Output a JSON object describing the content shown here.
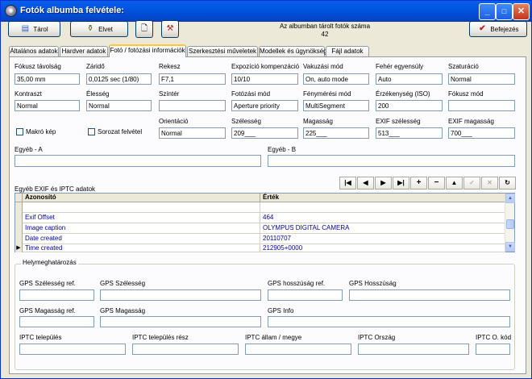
{
  "window": {
    "title": "Fotók albumba felvétele:",
    "min": "_",
    "max": "□",
    "close": "✕"
  },
  "toolbar": {
    "save_label": "Tárol",
    "discard_label": "Elvet",
    "album_count_label": "Az albumban tárolt fotók száma",
    "album_count": "42",
    "finish_label": "Befejezés"
  },
  "tabs": [
    "Általános adatok",
    "Hardver adatok",
    "Fotó / fotózási információk",
    "Szerkesztési műveletek",
    "Modellek és ügynökség",
    "Fájl adatok"
  ],
  "fields": {
    "focal_length": {
      "label": "Fókusz távolság",
      "value": "35,00 mm"
    },
    "shutter": {
      "label": "Záridő",
      "value": "0,0125 sec (1/80)"
    },
    "aperture": {
      "label": "Rekesz",
      "value": "F7,1"
    },
    "exposure_comp": {
      "label": "Expozíció kompenzáció",
      "value": "10/10"
    },
    "flash_mode": {
      "label": "Vakuzási mód",
      "value": "On, auto mode"
    },
    "white_balance": {
      "label": "Fehér egyensúly",
      "value": "Auto"
    },
    "saturation": {
      "label": "Szaturáció",
      "value": "Normal"
    },
    "contrast": {
      "label": "Kontraszt",
      "value": "Normal"
    },
    "sharpness": {
      "label": "Élesség",
      "value": "Normal"
    },
    "color_space": {
      "label": "Színtér",
      "value": ""
    },
    "shooting_mode": {
      "label": "Fotózási mód",
      "value": "Aperture priority"
    },
    "metering_mode": {
      "label": "Fénymérési mód",
      "value": "MultiSegment"
    },
    "iso": {
      "label": "Érzékenység (ISO)",
      "value": "200"
    },
    "focus_mode": {
      "label": "Fókusz mód",
      "value": ""
    },
    "orientation": {
      "label": "Orientáció",
      "value": "Normal"
    },
    "width": {
      "label": "Szélesség",
      "value": "209___"
    },
    "height": {
      "label": "Magasság",
      "value": "225___"
    },
    "exif_width": {
      "label": "EXIF szélesség",
      "value": "513___"
    },
    "exif_height": {
      "label": "EXIF magasság",
      "value": "700___"
    },
    "other_a": {
      "label": "Egyéb - A",
      "value": ""
    },
    "other_b": {
      "label": "Egyéb - B",
      "value": ""
    }
  },
  "checkboxes": {
    "macro": "Makró kép",
    "series": "Sorozat felvétel"
  },
  "grid": {
    "title": "Egyéb EXIF és IPTC adatok",
    "col_key": "Azonosító",
    "col_value": "Érték",
    "current_row_marker": "▶",
    "rows": [
      {
        "key": "",
        "value": ""
      },
      {
        "key": "Exif Offset",
        "value": "464"
      },
      {
        "key": "Image caption",
        "value": "OLYMPUS DIGITAL CAMERA"
      },
      {
        "key": "Date created",
        "value": "20110707"
      },
      {
        "key": "Time created",
        "value": "212905+0000"
      }
    ],
    "nav": [
      "|◀",
      "◀",
      "▶",
      "▶|",
      "+",
      "−",
      "▲",
      "✓",
      "✕",
      "↻"
    ]
  },
  "location": {
    "group_title": "Helymeghatározás",
    "gps_lat_ref": "GPS Szélesség ref.",
    "gps_lat": "GPS Szélesség",
    "gps_lon_ref": "GPS hosszúság ref.",
    "gps_lon": "GPS Hosszúság",
    "gps_alt_ref": "GPS Magasság ref.",
    "gps_alt": "GPS Magasság",
    "gps_info": "GPS Info",
    "iptc_city": "IPTC település",
    "iptc_sublocation": "IPTC település rész",
    "iptc_state": "IPTC állam / megye",
    "iptc_country": "IPTC Ország",
    "iptc_country_code": "IPTC O. kód"
  },
  "colors": {
    "titlebar": "#0054E3",
    "face": "#ECE9D8",
    "panel": "#FCFCFE",
    "data_text": "#0000A0"
  }
}
